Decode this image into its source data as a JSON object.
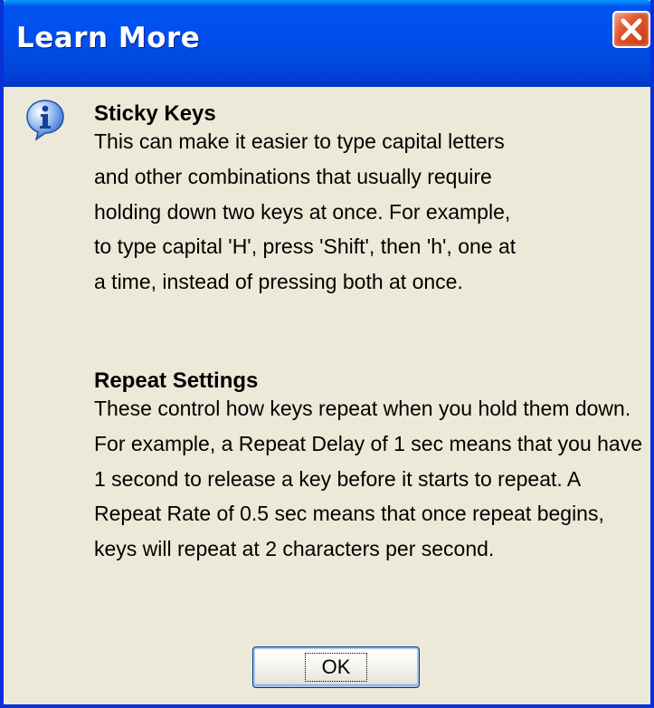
{
  "window": {
    "title": "Learn More"
  },
  "sections": [
    {
      "heading": "Sticky Keys",
      "body": "This can make it easier to type capital letters and other combinations that usually require holding down two keys at once. For example, to type capital 'H', press 'Shift', then 'h', one at a time, instead of pressing both at once."
    },
    {
      "heading": "Repeat Settings",
      "body": "These control how keys repeat when you hold them down. For example, a Repeat Delay of 1 sec means that you have 1 second to release a key before it starts to repeat. A Repeat Rate of 0.5 sec means that once repeat begins, keys will repeat at 2 characters per second."
    }
  ],
  "buttons": {
    "ok_label": "OK"
  },
  "icons": {
    "info": "info-icon",
    "close": "close-icon"
  },
  "colors": {
    "titlebar_blue": "#0053ee",
    "window_face": "#ece9d8",
    "close_red": "#e0542c"
  }
}
